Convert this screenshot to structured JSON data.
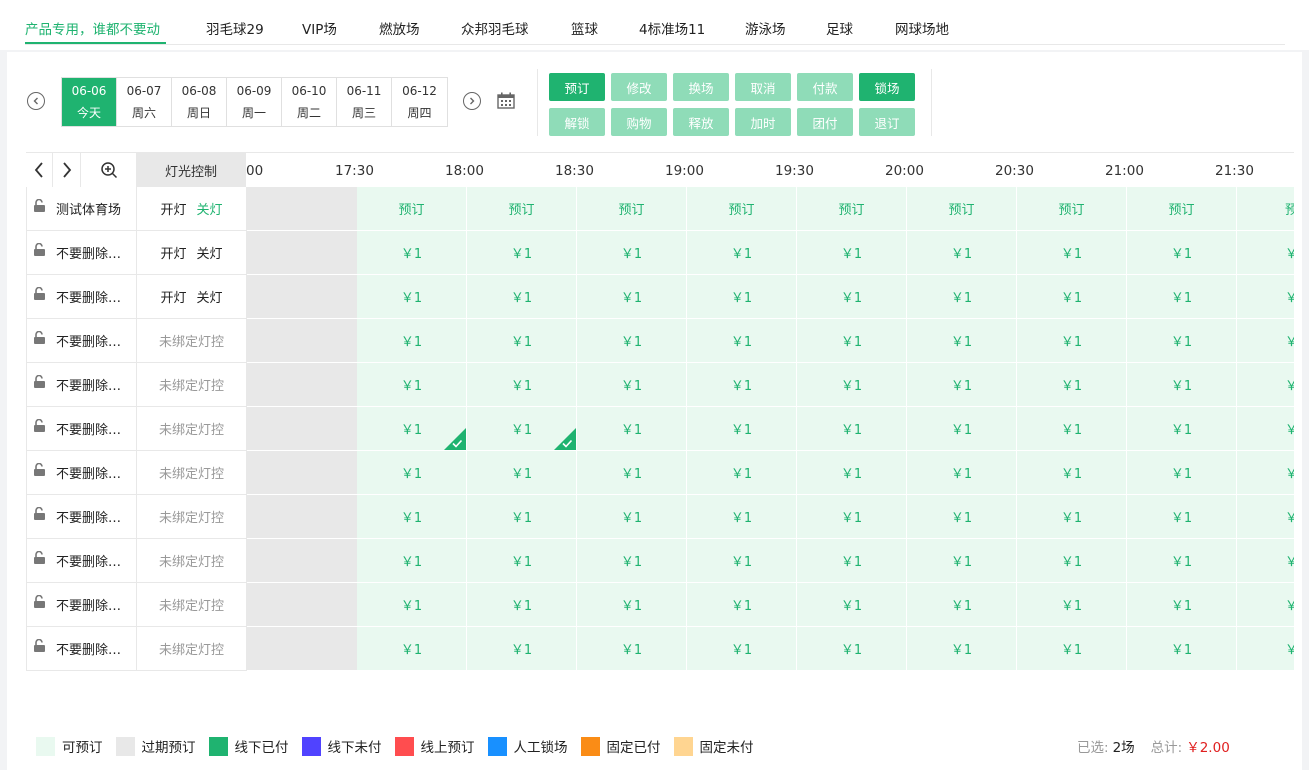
{
  "top_tabs": [
    {
      "label": "产品专用，谁都不要动",
      "active": true
    },
    {
      "label": "羽毛球29"
    },
    {
      "label": "VIP场"
    },
    {
      "label": "燃放场"
    },
    {
      "label": "众邦羽毛球"
    },
    {
      "label": "篮球"
    },
    {
      "label": "4标准场11"
    },
    {
      "label": "游泳场"
    },
    {
      "label": "足球"
    },
    {
      "label": "网球场地"
    }
  ],
  "dates": [
    {
      "date": "06-06",
      "weekday": "今天",
      "active": true
    },
    {
      "date": "06-07",
      "weekday": "周六"
    },
    {
      "date": "06-08",
      "weekday": "周日"
    },
    {
      "date": "06-09",
      "weekday": "周一"
    },
    {
      "date": "06-10",
      "weekday": "周二"
    },
    {
      "date": "06-11",
      "weekday": "周三"
    },
    {
      "date": "06-12",
      "weekday": "周四"
    }
  ],
  "actions": [
    {
      "label": "预订",
      "enabled": true
    },
    {
      "label": "修改",
      "enabled": false
    },
    {
      "label": "换场",
      "enabled": false
    },
    {
      "label": "取消",
      "enabled": false
    },
    {
      "label": "付款",
      "enabled": false
    },
    {
      "label": "锁场",
      "enabled": true
    },
    {
      "label": "解锁",
      "enabled": false
    },
    {
      "label": "购物",
      "enabled": false
    },
    {
      "label": "释放",
      "enabled": false
    },
    {
      "label": "加时",
      "enabled": false
    },
    {
      "label": "团付",
      "enabled": false
    },
    {
      "label": "退订",
      "enabled": false
    }
  ],
  "grid": {
    "light_header": "灯光控制",
    "times": [
      "00",
      "17:30",
      "18:00",
      "18:30",
      "19:00",
      "19:30",
      "20:00",
      "20:30",
      "21:00",
      "21:30"
    ],
    "rows": [
      {
        "name": "测试体育场",
        "light_on": "开灯",
        "light_off": "关灯",
        "off_active": true,
        "slot_text": "预订",
        "last_slot_text": "预"
      },
      {
        "name": "不要删除…",
        "light_on": "开灯",
        "light_off": "关灯",
        "slot_text": "￥1",
        "last_slot_text": "￥"
      },
      {
        "name": "不要删除…",
        "light_on": "开灯",
        "light_off": "关灯",
        "slot_text": "￥1",
        "last_slot_text": "￥"
      },
      {
        "name": "不要删除…",
        "unbound": "未绑定灯控",
        "slot_text": "￥1",
        "last_slot_text": "￥"
      },
      {
        "name": "不要删除…",
        "unbound": "未绑定灯控",
        "slot_text": "￥1",
        "last_slot_text": "￥"
      },
      {
        "name": "不要删除…",
        "unbound": "未绑定灯控",
        "slot_text": "￥1",
        "last_slot_text": "￥",
        "selected_slots": [
          0,
          1
        ]
      },
      {
        "name": "不要删除…",
        "unbound": "未绑定灯控",
        "slot_text": "￥1",
        "last_slot_text": "￥"
      },
      {
        "name": "不要删除…",
        "unbound": "未绑定灯控",
        "slot_text": "￥1",
        "last_slot_text": "￥"
      },
      {
        "name": "不要删除…",
        "unbound": "未绑定灯控",
        "slot_text": "￥1",
        "last_slot_text": "￥"
      },
      {
        "name": "不要删除…",
        "unbound": "未绑定灯控",
        "slot_text": "￥1",
        "last_slot_text": "￥"
      },
      {
        "name": "不要删除…",
        "unbound": "未绑定灯控",
        "slot_text": "￥1",
        "last_slot_text": "￥"
      }
    ]
  },
  "legend": [
    {
      "label": "可预订",
      "color": "#e9f9f0"
    },
    {
      "label": "过期预订",
      "color": "#e8e8e8"
    },
    {
      "label": "线下已付",
      "color": "#1fb370"
    },
    {
      "label": "线下未付",
      "color": "#5043ff"
    },
    {
      "label": "线上预订",
      "color": "#ff4d4f"
    },
    {
      "label": "人工锁场",
      "color": "#1890ff"
    },
    {
      "label": "固定已付",
      "color": "#fa8c16"
    },
    {
      "label": "固定未付",
      "color": "#ffd591"
    }
  ],
  "summary": {
    "selected_label": "已选:",
    "selected_value": "2场",
    "total_label": "总计:",
    "total_value": "￥2.00"
  },
  "colors": {
    "accent": "#1fb370",
    "accent_light": "#8fdcb8",
    "slot_bg": "#e9f9f0",
    "expired_bg": "#e8e8e8",
    "price_red": "#e02020"
  }
}
